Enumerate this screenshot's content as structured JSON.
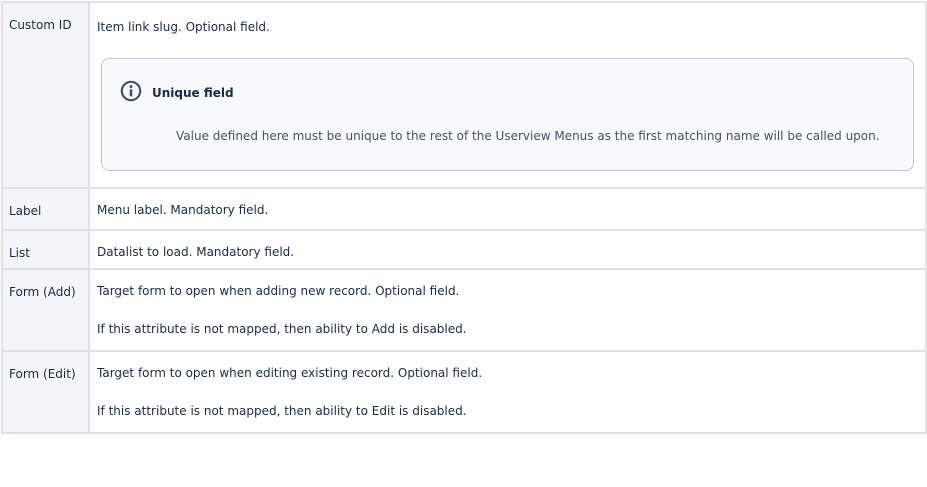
{
  "rows": [
    {
      "name": "Custom ID",
      "lines": [
        "Item link slug. Optional field."
      ],
      "panel": {
        "title": "Unique field",
        "body": "Value defined here must be unique to the rest of the Userview Menus as the first matching name will be called upon.",
        "icon": "info-icon"
      }
    },
    {
      "name": "Label",
      "lines": [
        "Menu label. Mandatory field."
      ]
    },
    {
      "name": "List",
      "lines": [
        "Datalist to load. Mandatory field."
      ]
    },
    {
      "name": "Form (Add)",
      "lines": [
        "Target form to open when adding new record. Optional field.",
        "If this attribute is not mapped, then ability to Add is disabled."
      ]
    },
    {
      "name": "Form (Edit)",
      "lines": [
        "Target form to open when editing existing record. Optional field.",
        "If this attribute is not mapped, then ability to Edit is disabled."
      ]
    }
  ],
  "colors": {
    "border": "#dfe1e6",
    "header_bg": "#f4f5f7",
    "panel_bg": "#f8f9fa",
    "icon": "#42526e"
  }
}
